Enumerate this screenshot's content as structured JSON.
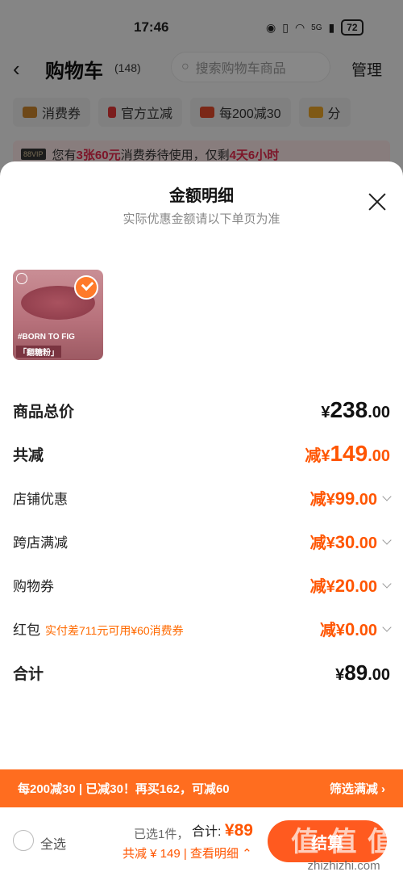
{
  "status_bar": {
    "time": "17:46",
    "network": "5G",
    "battery": "72"
  },
  "header": {
    "title": "购物车",
    "count": "(148)",
    "search_placeholder": "搜索购物车商品",
    "manage": "管理"
  },
  "chips": [
    {
      "label": "消费券",
      "icon": "ticket-icon",
      "color": "#c9842d"
    },
    {
      "label": "官方立减",
      "icon": "lightning-icon",
      "color": "#e03636"
    },
    {
      "label": "每200减30",
      "icon": "shop-icon",
      "color": "#e04a2a"
    },
    {
      "label": "分",
      "icon": "folder-icon",
      "color": "#e8a327"
    }
  ],
  "vip_banner": {
    "tag": "88VIP",
    "text_prefix": "您有",
    "highlight1": "3张60元",
    "text_mid": "消费券待使用，仅剩",
    "highlight2": "4天6小时"
  },
  "sheet": {
    "title": "金额明细",
    "subtitle": "实际优惠金额请以下单页为准",
    "product": {
      "line1": "#BORN TO FIG",
      "line2": "「翻糖粉」"
    },
    "rows": {
      "subtotal": {
        "label": "商品总价",
        "symbol": "¥",
        "int": "238",
        "dec": ".00"
      },
      "discount": {
        "label": "共减",
        "prefix": "减¥",
        "int": "149",
        "dec": ".00"
      },
      "shop": {
        "label": "店铺优惠",
        "prefix": "减¥",
        "int": "99",
        "dec": ".00"
      },
      "cross": {
        "label": "跨店满减",
        "prefix": "减¥",
        "int": "30",
        "dec": ".00"
      },
      "voucher": {
        "label": "购物券",
        "prefix": "减¥",
        "int": "20",
        "dec": ".00"
      },
      "redpacket": {
        "label": "红包",
        "hint": "实付差711元可用¥60消费券",
        "prefix": "减¥",
        "int": "0",
        "dec": ".00"
      },
      "total": {
        "label": "合计",
        "symbol": "¥",
        "int": "89",
        "dec": ".00"
      }
    }
  },
  "promo": {
    "text": "每200减30 | 已减30！再买162，可减60",
    "action": "筛选满减 ›"
  },
  "bottom": {
    "select_all": "全选",
    "selected": "已选1件，",
    "total_label": "合计:",
    "total_value": "¥89",
    "reduce": "共减 ¥ 149 | 查看明细 ⌃",
    "checkout": "结算",
    "watermark": "值 值 值",
    "watermark_url": "zhizhizhi.com"
  }
}
